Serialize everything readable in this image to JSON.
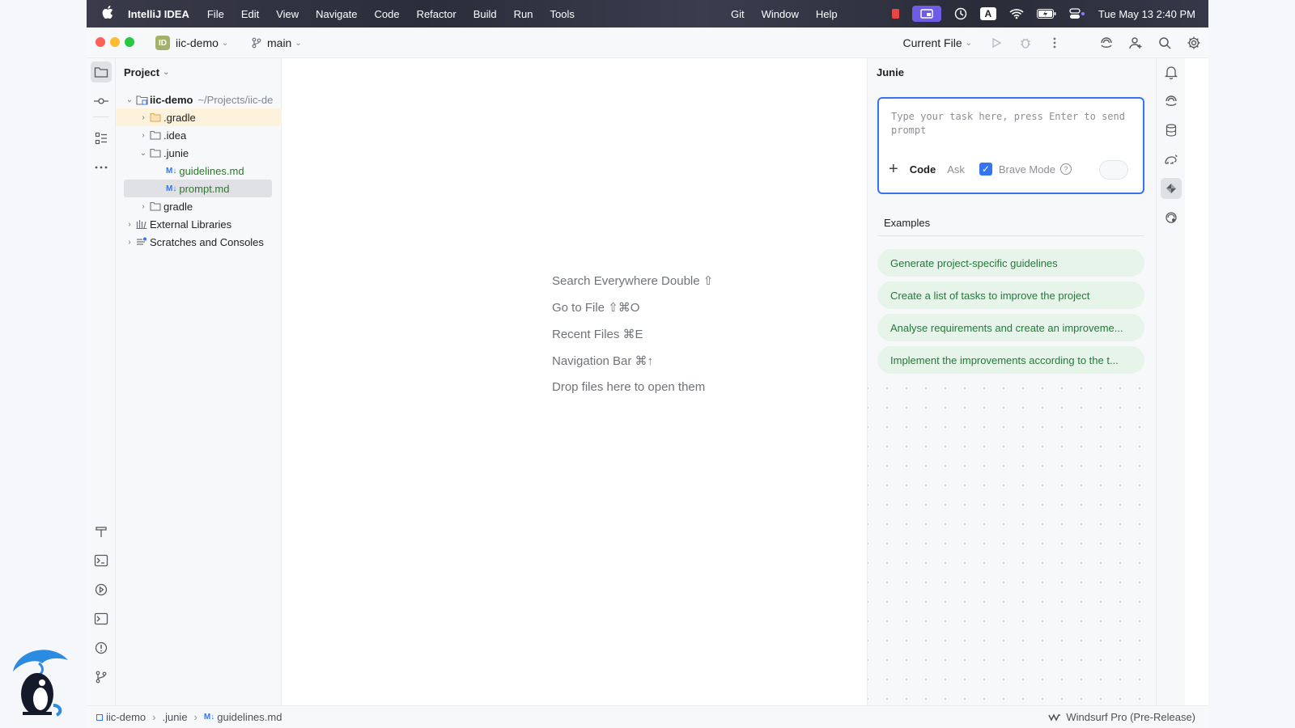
{
  "menubar": {
    "app": "IntelliJ IDEA",
    "items": [
      "File",
      "Edit",
      "View",
      "Navigate",
      "Code",
      "Refactor",
      "Build",
      "Run",
      "Tools"
    ],
    "items_mid": [
      "Git",
      "Window",
      "Help"
    ],
    "clock": "Tue May 13  2:40 PM",
    "input_source": "A"
  },
  "titlebar": {
    "project_badge": "ID",
    "project": "iic-demo",
    "branch": "main",
    "run_config": "Current File"
  },
  "project_panel": {
    "title": "Project",
    "tree": [
      {
        "label": "iic-demo",
        "path": "~/Projects/iic-de"
      },
      {
        "label": ".gradle"
      },
      {
        "label": ".idea"
      },
      {
        "label": ".junie"
      },
      {
        "label": "guidelines.md"
      },
      {
        "label": "prompt.md"
      },
      {
        "label": "gradle"
      },
      {
        "label": "External Libraries"
      },
      {
        "label": "Scratches and Consoles"
      }
    ],
    "md_badge": "M↓"
  },
  "editor": {
    "hints": [
      "Search Everywhere Double ⇧",
      "Go to File ⇧⌘O",
      "Recent Files ⌘E",
      "Navigation Bar ⌘↑",
      "Drop files here to open them"
    ]
  },
  "junie": {
    "title": "Junie",
    "placeholder": "Type your task here, press Enter to send prompt",
    "mode_code": "Code",
    "mode_ask": "Ask",
    "brave_mode": "Brave Mode",
    "brave_checked": true,
    "examples_heading": "Examples",
    "examples": [
      "Generate project-specific guidelines",
      "Create a list of tasks to improve the project",
      "Analyse requirements and create an improveme...",
      "Implement the improvements according to the t..."
    ]
  },
  "statusbar": {
    "breadcrumbs": [
      "iic-demo",
      ".junie",
      "guidelines.md"
    ],
    "right": "Windsurf Pro (Pre-Release)"
  },
  "colors": {
    "accent": "#3574f0",
    "example_bg": "#e6f4e9",
    "example_text": "#207a3a",
    "highlight_row": "#fdf2dc"
  }
}
